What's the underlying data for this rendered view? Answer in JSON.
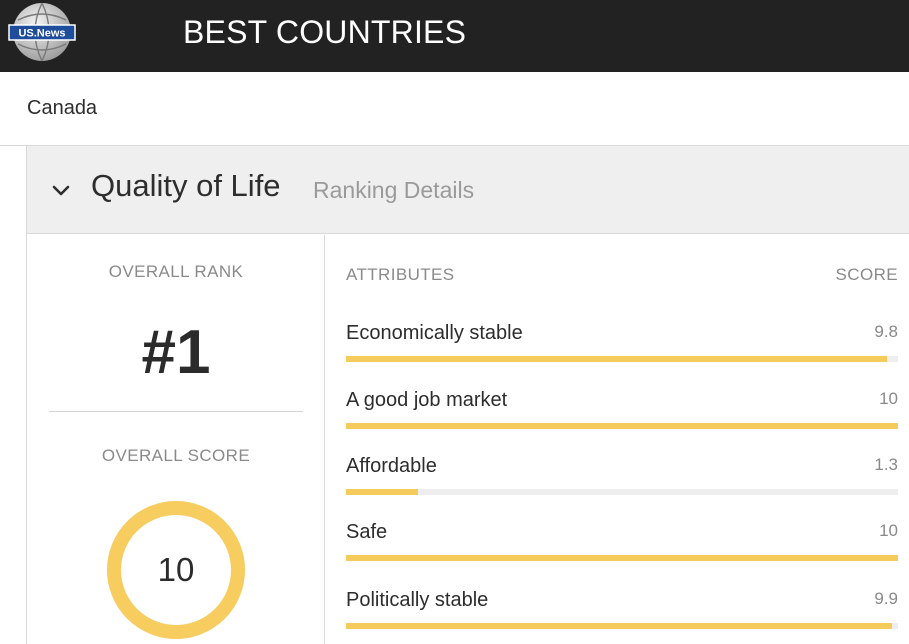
{
  "header": {
    "logo_text": "US.News",
    "brand": "BEST COUNTRIES"
  },
  "breadcrumb": {
    "country": "Canada"
  },
  "section": {
    "title": "Quality of Life",
    "subtitle": "Ranking Details",
    "toggle_icon": "chevron-down-icon"
  },
  "overall": {
    "rank_label": "OVERALL RANK",
    "rank_value": "#1",
    "score_label": "OVERALL SCORE",
    "score_value": "10",
    "score_fraction": 1.0
  },
  "attributes_table": {
    "header_attributes": "ATTRIBUTES",
    "header_score": "SCORE",
    "rows": [
      {
        "name": "Economically stable",
        "score": "9.8",
        "fraction": 0.98
      },
      {
        "name": "A good job market",
        "score": "10",
        "fraction": 1.0
      },
      {
        "name": "Affordable",
        "score": "1.3",
        "fraction": 0.13
      },
      {
        "name": "Safe",
        "score": "10",
        "fraction": 1.0
      },
      {
        "name": "Politically stable",
        "score": "9.9",
        "fraction": 0.99
      }
    ]
  },
  "colors": {
    "topbar": "#222222",
    "accent_bar": "#f5cb5c",
    "ring": "#f7cd60",
    "panel_header": "#efefef"
  }
}
